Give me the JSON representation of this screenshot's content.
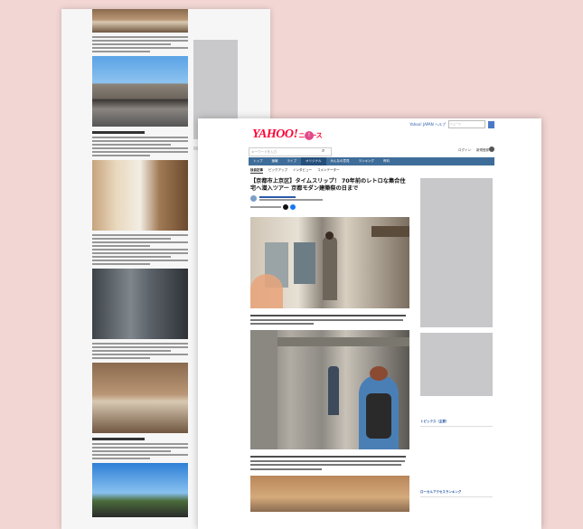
{
  "front": {
    "top_links": "Yahoo! JAPAN ヘルプ",
    "search_placeholder_top": "ニュース",
    "logo_main": "YAHOO!",
    "logo_sub": "ニュース",
    "search_placeholder": "キーワードを入力",
    "user_links": [
      "ログイン",
      "新規登録"
    ],
    "nav": [
      "トップ",
      "速報",
      "ライブ",
      "オリジナル",
      "みんなの意見",
      "ランキング",
      "有料"
    ],
    "nav_active_index": 3,
    "subnav": [
      "独自記事",
      "ピックアップ",
      "インタビュー",
      "コメンテーター"
    ],
    "subnav_active_index": 0,
    "headline": "【京都市上京区】タイムスリップ！ 70年前のレトロな集合住宅へ潜入ツアー 京都モダン建築祭の日まで",
    "sidebar": {
      "topics_heading": "トピックス（主要）",
      "ranking_heading": "ローカルアクセスランキング"
    }
  },
  "colors": {
    "background": "#f2d6d3",
    "nav_bar": "#3f6d99",
    "logo_red": "#ff0033",
    "link_blue": "#2a5aa8"
  }
}
